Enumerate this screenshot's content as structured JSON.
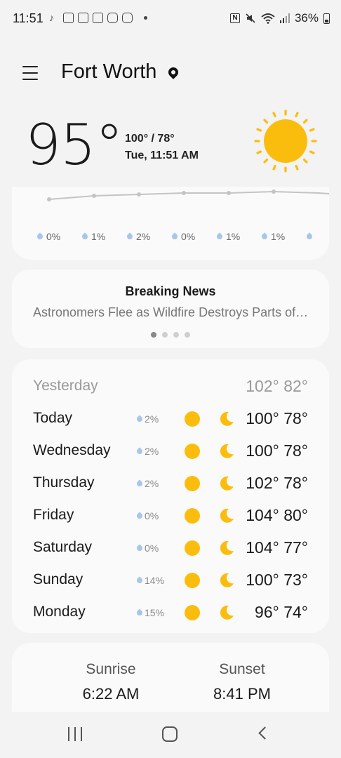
{
  "status_bar": {
    "time": "11:51",
    "battery": "36%",
    "left_icons": [
      "tiktok-icon",
      "news-icon",
      "news-icon",
      "mail-icon",
      "instagram-icon",
      "instagram-icon",
      "more-dot-icon"
    ],
    "right_icons": [
      "nfc-icon",
      "mute-icon",
      "wifi-icon",
      "signal-icon",
      "battery-icon"
    ]
  },
  "header": {
    "city": "Fort Worth",
    "menu_icon": "hamburger-menu-icon",
    "location_icon": "location-pin-icon"
  },
  "current": {
    "temperature": "95°",
    "hi_lo": "100° / 78°",
    "datetime": "Tue, 11:51 AM",
    "condition_icon": "sunny-icon"
  },
  "hourly": {
    "precip": [
      "0%",
      "1%",
      "2%",
      "0%",
      "1%",
      "1%"
    ]
  },
  "news": {
    "title": "Breaking News",
    "headline": "Astronomers Flee as Wildfire Destroys Parts of Observatory",
    "page_count": 4,
    "active_page": 1
  },
  "daily": {
    "yesterday": {
      "label": "Yesterday",
      "temps": "102° 82°"
    },
    "days": [
      {
        "name": "Today",
        "rain": "2%",
        "temps": "100° 78°"
      },
      {
        "name": "Wednesday",
        "rain": "2%",
        "temps": "100° 78°"
      },
      {
        "name": "Thursday",
        "rain": "2%",
        "temps": "102° 78°"
      },
      {
        "name": "Friday",
        "rain": "0%",
        "temps": "104° 80°"
      },
      {
        "name": "Saturday",
        "rain": "0%",
        "temps": "104° 77°"
      },
      {
        "name": "Sunday",
        "rain": "14%",
        "temps": "100° 73°"
      },
      {
        "name": "Monday",
        "rain": "15%",
        "temps": "96° 74°"
      }
    ]
  },
  "sun": {
    "sunrise_label": "Sunrise",
    "sunrise_time": "6:22 AM",
    "sunset_label": "Sunset",
    "sunset_time": "8:41 PM"
  },
  "colors": {
    "sun": "#fbbd0d",
    "rain_drop": "#a7c7e8",
    "card": "#fafafa",
    "background": "#f3f3f3"
  }
}
